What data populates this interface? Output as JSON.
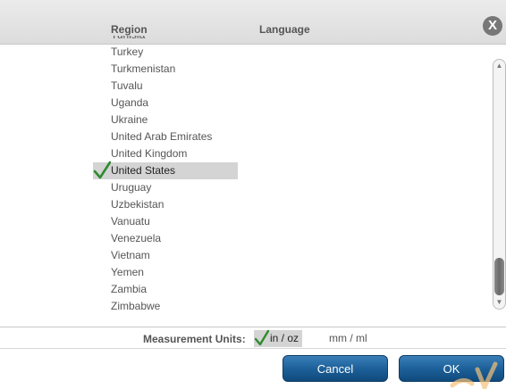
{
  "header": {
    "region_label": "Region",
    "language_label": "Language",
    "close_label": "X"
  },
  "regions": [
    {
      "label": "Tunisia",
      "selected": false
    },
    {
      "label": "Turkey",
      "selected": false
    },
    {
      "label": "Turkmenistan",
      "selected": false
    },
    {
      "label": "Tuvalu",
      "selected": false
    },
    {
      "label": "Uganda",
      "selected": false
    },
    {
      "label": "Ukraine",
      "selected": false
    },
    {
      "label": "United Arab Emirates",
      "selected": false
    },
    {
      "label": "United Kingdom",
      "selected": false
    },
    {
      "label": "United States",
      "selected": true
    },
    {
      "label": "Uruguay",
      "selected": false
    },
    {
      "label": "Uzbekistan",
      "selected": false
    },
    {
      "label": "Vanuatu",
      "selected": false
    },
    {
      "label": "Venezuela",
      "selected": false
    },
    {
      "label": "Vietnam",
      "selected": false
    },
    {
      "label": "Yemen",
      "selected": false
    },
    {
      "label": "Zambia",
      "selected": false
    },
    {
      "label": "Zimbabwe",
      "selected": false
    }
  ],
  "units": {
    "label": "Measurement Units:",
    "options": [
      {
        "label": "in / oz",
        "selected": true
      },
      {
        "label": "mm / ml",
        "selected": false
      }
    ]
  },
  "buttons": {
    "cancel_label": "Cancel",
    "ok_label": "OK"
  },
  "icons": {
    "checkmark": "checkmark-icon",
    "close": "close-icon",
    "scroll_up": "arrow-up-icon",
    "scroll_down": "arrow-down-icon"
  },
  "colors": {
    "check_green": "#2e8b2e",
    "button_blue": "#1b5e97",
    "selection_gray": "#d4d4d4"
  }
}
